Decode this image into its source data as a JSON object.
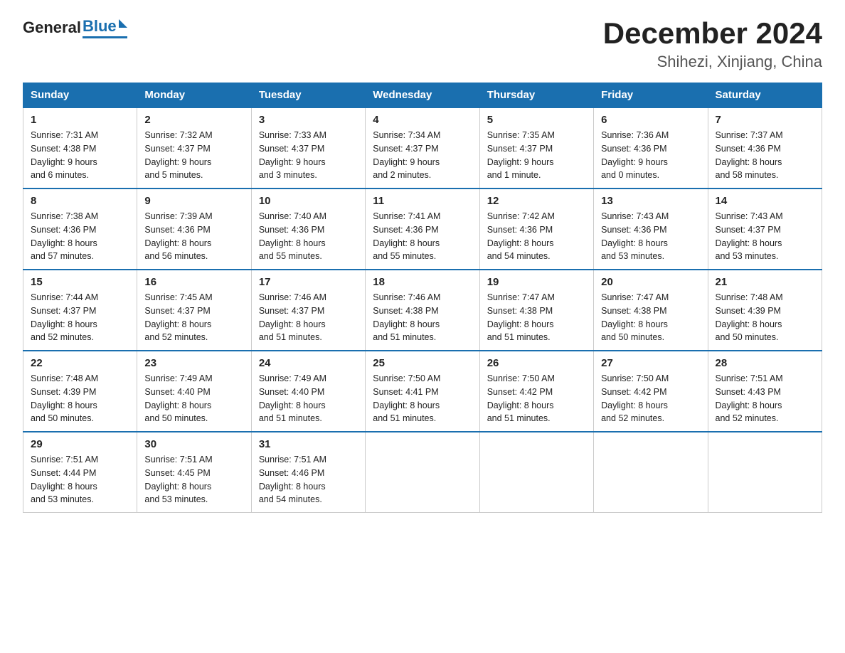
{
  "logo": {
    "general": "General",
    "blue": "Blue"
  },
  "title": "December 2024",
  "subtitle": "Shihezi, Xinjiang, China",
  "days_of_week": [
    "Sunday",
    "Monday",
    "Tuesday",
    "Wednesday",
    "Thursday",
    "Friday",
    "Saturday"
  ],
  "weeks": [
    [
      {
        "day": "1",
        "sunrise": "7:31 AM",
        "sunset": "4:38 PM",
        "daylight": "9 hours and 6 minutes."
      },
      {
        "day": "2",
        "sunrise": "7:32 AM",
        "sunset": "4:37 PM",
        "daylight": "9 hours and 5 minutes."
      },
      {
        "day": "3",
        "sunrise": "7:33 AM",
        "sunset": "4:37 PM",
        "daylight": "9 hours and 3 minutes."
      },
      {
        "day": "4",
        "sunrise": "7:34 AM",
        "sunset": "4:37 PM",
        "daylight": "9 hours and 2 minutes."
      },
      {
        "day": "5",
        "sunrise": "7:35 AM",
        "sunset": "4:37 PM",
        "daylight": "9 hours and 1 minute."
      },
      {
        "day": "6",
        "sunrise": "7:36 AM",
        "sunset": "4:36 PM",
        "daylight": "9 hours and 0 minutes."
      },
      {
        "day": "7",
        "sunrise": "7:37 AM",
        "sunset": "4:36 PM",
        "daylight": "8 hours and 58 minutes."
      }
    ],
    [
      {
        "day": "8",
        "sunrise": "7:38 AM",
        "sunset": "4:36 PM",
        "daylight": "8 hours and 57 minutes."
      },
      {
        "day": "9",
        "sunrise": "7:39 AM",
        "sunset": "4:36 PM",
        "daylight": "8 hours and 56 minutes."
      },
      {
        "day": "10",
        "sunrise": "7:40 AM",
        "sunset": "4:36 PM",
        "daylight": "8 hours and 55 minutes."
      },
      {
        "day": "11",
        "sunrise": "7:41 AM",
        "sunset": "4:36 PM",
        "daylight": "8 hours and 55 minutes."
      },
      {
        "day": "12",
        "sunrise": "7:42 AM",
        "sunset": "4:36 PM",
        "daylight": "8 hours and 54 minutes."
      },
      {
        "day": "13",
        "sunrise": "7:43 AM",
        "sunset": "4:36 PM",
        "daylight": "8 hours and 53 minutes."
      },
      {
        "day": "14",
        "sunrise": "7:43 AM",
        "sunset": "4:37 PM",
        "daylight": "8 hours and 53 minutes."
      }
    ],
    [
      {
        "day": "15",
        "sunrise": "7:44 AM",
        "sunset": "4:37 PM",
        "daylight": "8 hours and 52 minutes."
      },
      {
        "day": "16",
        "sunrise": "7:45 AM",
        "sunset": "4:37 PM",
        "daylight": "8 hours and 52 minutes."
      },
      {
        "day": "17",
        "sunrise": "7:46 AM",
        "sunset": "4:37 PM",
        "daylight": "8 hours and 51 minutes."
      },
      {
        "day": "18",
        "sunrise": "7:46 AM",
        "sunset": "4:38 PM",
        "daylight": "8 hours and 51 minutes."
      },
      {
        "day": "19",
        "sunrise": "7:47 AM",
        "sunset": "4:38 PM",
        "daylight": "8 hours and 51 minutes."
      },
      {
        "day": "20",
        "sunrise": "7:47 AM",
        "sunset": "4:38 PM",
        "daylight": "8 hours and 50 minutes."
      },
      {
        "day": "21",
        "sunrise": "7:48 AM",
        "sunset": "4:39 PM",
        "daylight": "8 hours and 50 minutes."
      }
    ],
    [
      {
        "day": "22",
        "sunrise": "7:48 AM",
        "sunset": "4:39 PM",
        "daylight": "8 hours and 50 minutes."
      },
      {
        "day": "23",
        "sunrise": "7:49 AM",
        "sunset": "4:40 PM",
        "daylight": "8 hours and 50 minutes."
      },
      {
        "day": "24",
        "sunrise": "7:49 AM",
        "sunset": "4:40 PM",
        "daylight": "8 hours and 51 minutes."
      },
      {
        "day": "25",
        "sunrise": "7:50 AM",
        "sunset": "4:41 PM",
        "daylight": "8 hours and 51 minutes."
      },
      {
        "day": "26",
        "sunrise": "7:50 AM",
        "sunset": "4:42 PM",
        "daylight": "8 hours and 51 minutes."
      },
      {
        "day": "27",
        "sunrise": "7:50 AM",
        "sunset": "4:42 PM",
        "daylight": "8 hours and 52 minutes."
      },
      {
        "day": "28",
        "sunrise": "7:51 AM",
        "sunset": "4:43 PM",
        "daylight": "8 hours and 52 minutes."
      }
    ],
    [
      {
        "day": "29",
        "sunrise": "7:51 AM",
        "sunset": "4:44 PM",
        "daylight": "8 hours and 53 minutes."
      },
      {
        "day": "30",
        "sunrise": "7:51 AM",
        "sunset": "4:45 PM",
        "daylight": "8 hours and 53 minutes."
      },
      {
        "day": "31",
        "sunrise": "7:51 AM",
        "sunset": "4:46 PM",
        "daylight": "8 hours and 54 minutes."
      },
      null,
      null,
      null,
      null
    ]
  ],
  "labels": {
    "sunrise": "Sunrise:",
    "sunset": "Sunset:",
    "daylight": "Daylight:"
  }
}
